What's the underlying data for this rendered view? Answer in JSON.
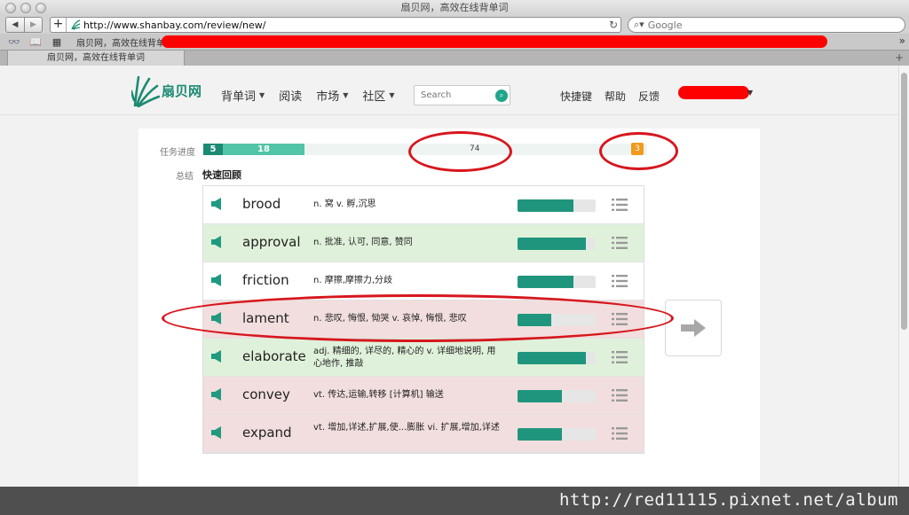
{
  "browser": {
    "window_title": "扇贝网，高效在线背单词",
    "address": "http://www.shanbay.com/review/new/",
    "search_placeholder": "Google",
    "bookmark_label": "扇贝网，高效在线背单词",
    "tab_title": "扇贝网，高效在线背单词"
  },
  "site": {
    "logo_text": "扇贝网",
    "nav": [
      {
        "label": "背单词",
        "caret": true
      },
      {
        "label": "阅读",
        "caret": false
      },
      {
        "label": "市场",
        "caret": true
      },
      {
        "label": "社区",
        "caret": true
      }
    ],
    "search_placeholder": "Search",
    "right_nav": [
      "快捷键",
      "帮助",
      "反馈"
    ],
    "brand_color": "#1c8a73"
  },
  "review": {
    "progress_label": "任务进度",
    "seg_done": "5",
    "seg_review": "18",
    "remaining": "74",
    "badge": "3",
    "summary_label": "总结",
    "summary_value": "快速回顾",
    "words": [
      {
        "word": "brood",
        "def": "n. 窝 v. 孵,沉思",
        "mastery": 0.72,
        "status": "neutral"
      },
      {
        "word": "approval",
        "def": "n. 批准, 认可, 同意, 赞同",
        "mastery": 0.87,
        "status": "known"
      },
      {
        "word": "friction",
        "def": "n. 摩擦,摩擦力,分歧",
        "mastery": 0.72,
        "status": "neutral"
      },
      {
        "word": "lament",
        "def": "n. 悲叹, 悔恨, 恸哭 v. 哀悼, 悔恨, 悲叹",
        "mastery": 0.43,
        "status": "unknown"
      },
      {
        "word": "elaborate",
        "def": "adj. 精细的, 详尽的, 精心的 v. 详细地说明, 用心地作, 推敲",
        "mastery": 0.87,
        "status": "known"
      },
      {
        "word": "convey",
        "def": "vt. 传达,运输,转移 [计算机] 输送",
        "mastery": 0.57,
        "status": "unknown"
      },
      {
        "word": "expand",
        "def": "vt. 增加,详述,扩展,使...膨胀 vi. 扩展,增加,详述",
        "mastery": 0.57,
        "status": "unknown"
      }
    ]
  },
  "colors": {
    "known_row": "#e0f1db",
    "unknown_row": "#f2dede",
    "neutral_row": "#ffffff",
    "bar_fill": "#20957d",
    "annotation_red": "#d7161d"
  },
  "watermark": "http://red11115.pixnet.net/album"
}
